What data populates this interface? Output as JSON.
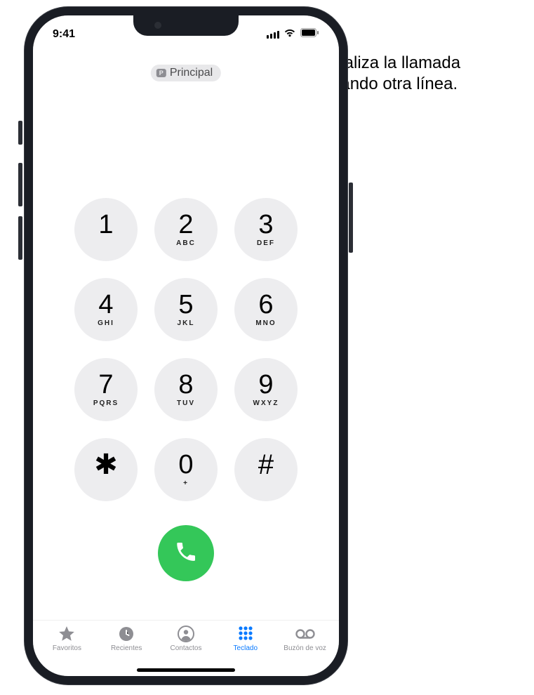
{
  "status": {
    "time": "9:41"
  },
  "line_selector": {
    "badge": "P",
    "label": "Principal"
  },
  "keypad": [
    {
      "digit": "1",
      "letters": ""
    },
    {
      "digit": "2",
      "letters": "ABC"
    },
    {
      "digit": "3",
      "letters": "DEF"
    },
    {
      "digit": "4",
      "letters": "GHI"
    },
    {
      "digit": "5",
      "letters": "JKL"
    },
    {
      "digit": "6",
      "letters": "MNO"
    },
    {
      "digit": "7",
      "letters": "PQRS"
    },
    {
      "digit": "8",
      "letters": "TUV"
    },
    {
      "digit": "9",
      "letters": "WXYZ"
    },
    {
      "digit": "✱",
      "letters": ""
    },
    {
      "digit": "0",
      "letters": "+"
    },
    {
      "digit": "#",
      "letters": ""
    }
  ],
  "tabs": {
    "favorites": "Favoritos",
    "recents": "Recientes",
    "contacts": "Contactos",
    "keypad": "Teclado",
    "voicemail": "Buzón de voz"
  },
  "callout": {
    "text": "Realiza la llamada usando otra línea."
  }
}
